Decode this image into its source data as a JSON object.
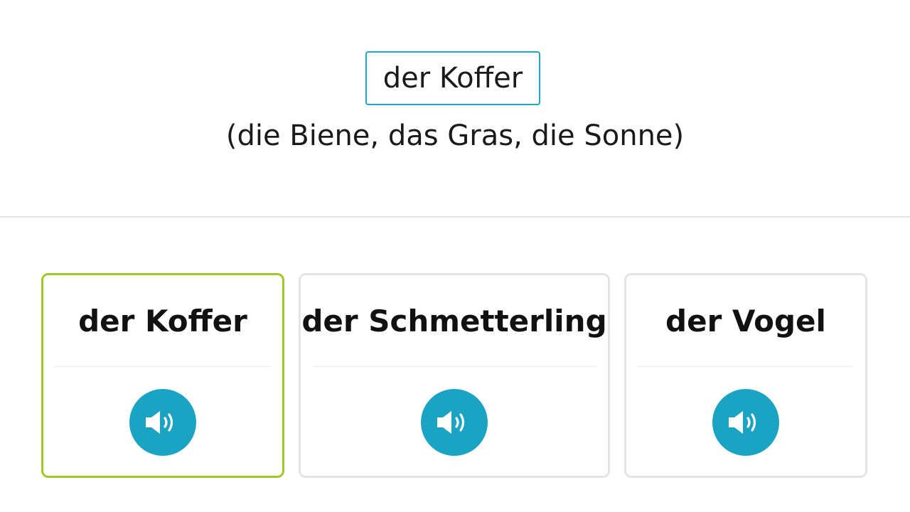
{
  "prompt": {
    "answer_text": "der Koffer",
    "hint_text": "(die Biene, das Gras, die Sonne)"
  },
  "cards": [
    {
      "word": "der Koffer",
      "selected": true,
      "icon": "speaker-icon"
    },
    {
      "word": "der Schmetterling",
      "selected": false,
      "icon": "speaker-icon"
    },
    {
      "word": "der Vogel",
      "selected": false,
      "icon": "speaker-icon"
    }
  ],
  "colors": {
    "accent": "#1fa6c9",
    "selected_border": "#9ccb26",
    "card_border": "#e4e4e4",
    "audio_button": "#1ba3c4"
  }
}
